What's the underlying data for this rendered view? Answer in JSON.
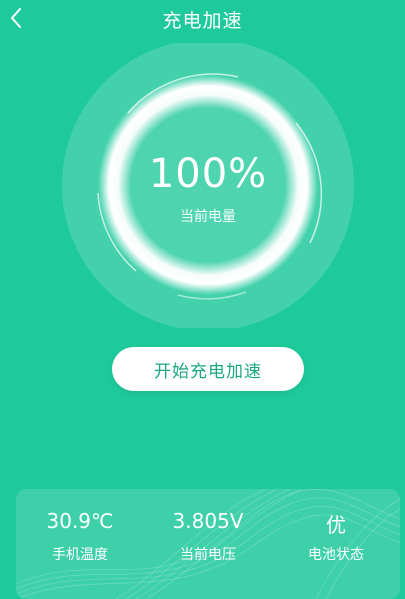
{
  "header": {
    "title": "充电加速",
    "back_icon": "chevron-left-icon"
  },
  "battery": {
    "percent_text": "100%",
    "level": 100,
    "label": "当前电量"
  },
  "action": {
    "start_label": "开始充电加速"
  },
  "stats": [
    {
      "value": "30.9℃",
      "label": "手机温度"
    },
    {
      "value": "3.805V",
      "label": "当前电压"
    },
    {
      "value": "优",
      "label": "电池状态"
    }
  ],
  "colors": {
    "background": "#1ec99b",
    "button_text": "#1aa883",
    "foreground": "#ffffff"
  }
}
